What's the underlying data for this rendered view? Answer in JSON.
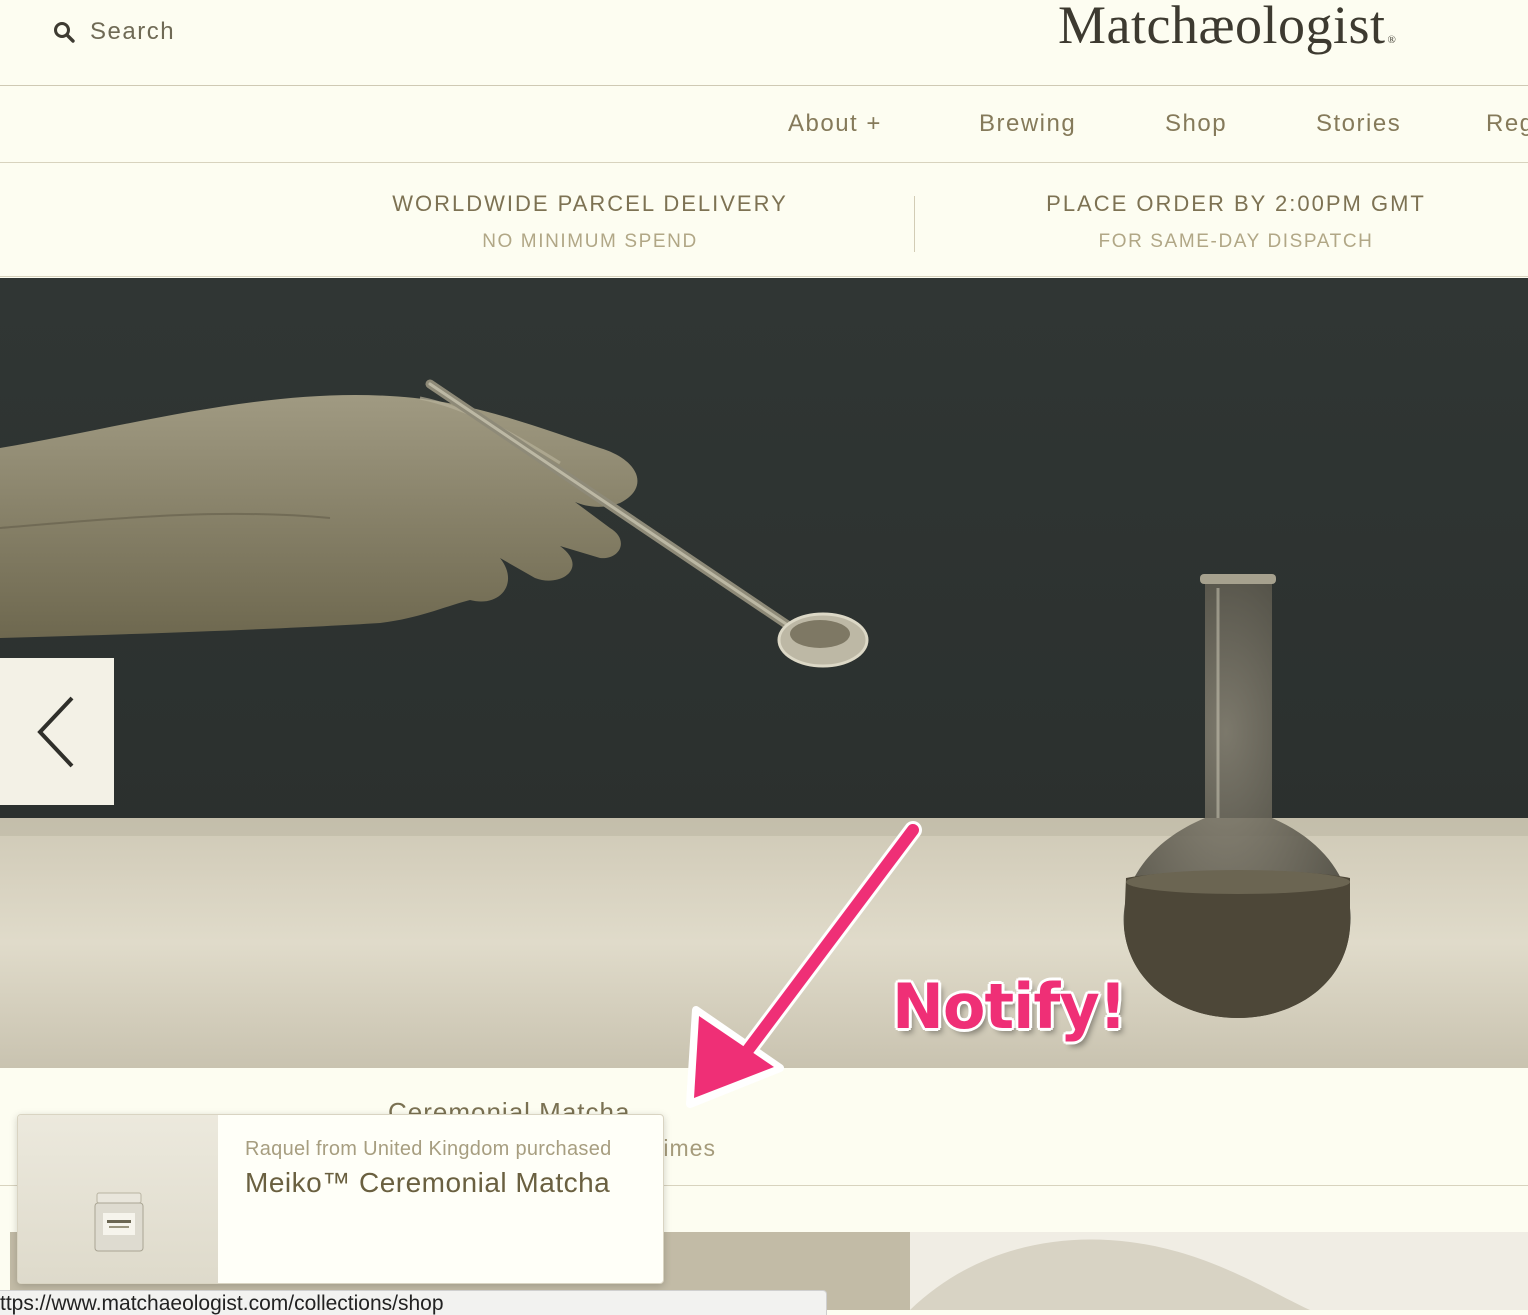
{
  "header": {
    "search_label": "Search",
    "logo_text": "Matchæologist",
    "logo_mark": "®"
  },
  "nav": {
    "items": [
      {
        "label": "About  +"
      },
      {
        "label": "Brewing"
      },
      {
        "label": "Shop"
      },
      {
        "label": "Stories"
      },
      {
        "label": "Reg"
      }
    ]
  },
  "info_strip": {
    "left_title": "WORLDWIDE PARCEL DELIVERY",
    "left_sub": "NO MINIMUM SPEND",
    "right_title": "PLACE ORDER BY 2:00PM GMT",
    "right_sub": "FOR SAME-DAY DISPATCH"
  },
  "hero": {
    "prev_icon": "chevron-left-icon"
  },
  "annotation": {
    "text": "Notify!",
    "color": "#ef2f76"
  },
  "caption": {
    "title": "Ceremonial Matcha",
    "subtitle": "times"
  },
  "toast": {
    "meta": "Raquel from United Kingdom purchased",
    "product": "Meiko™ Ceremonial Matcha"
  },
  "status_bar": {
    "url": "ttps://www.matchaeologist.com/collections/shop"
  }
}
